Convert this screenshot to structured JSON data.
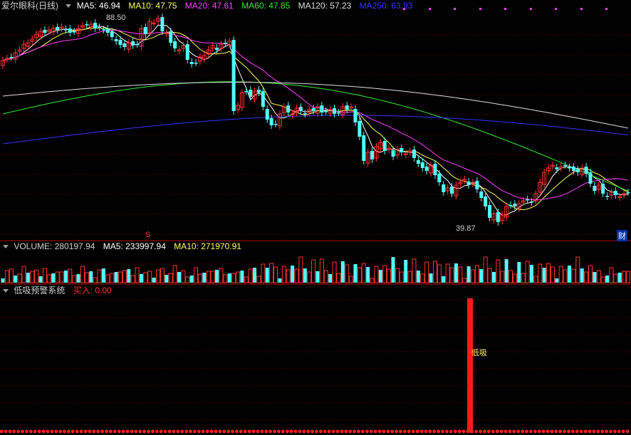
{
  "main_panel": {
    "title": "爱尔眼科(日线)",
    "indicators": [
      {
        "label": "MA5: 46.94",
        "color": "#ffffff"
      },
      {
        "label": "MA10: 47.75",
        "color": "#ffff55"
      },
      {
        "label": "MA20: 47.61",
        "color": "#ff40ff"
      },
      {
        "label": "MA60: 47.85",
        "color": "#33ee33"
      },
      {
        "label": "MA120: 57.23",
        "color": "#dddddd"
      },
      {
        "label": "MA250: 63.93",
        "color": "#3333ff"
      }
    ],
    "high_label": "88.50",
    "low_label": "39.87",
    "marker_s": "S",
    "marker_cai": "财"
  },
  "volume_panel": {
    "title": "VOLUME: 280197.94",
    "indicators": [
      {
        "label": "MA5: 233997.94",
        "color": "#ffffff"
      },
      {
        "label": "MA10: 271970.91",
        "color": "#ffff55"
      }
    ]
  },
  "signal_panel": {
    "title": "低吸预警系统",
    "buy_label": "买入: 0.00",
    "signal_text": "低吸"
  },
  "chart_data": {
    "type": "candlestick",
    "price_range": [
      39.87,
      88.5
    ],
    "colors": {
      "up": "#ff3232",
      "down": "#54fcfc",
      "grid": "#7a0000",
      "dotted": "#ff40ff"
    }
  }
}
